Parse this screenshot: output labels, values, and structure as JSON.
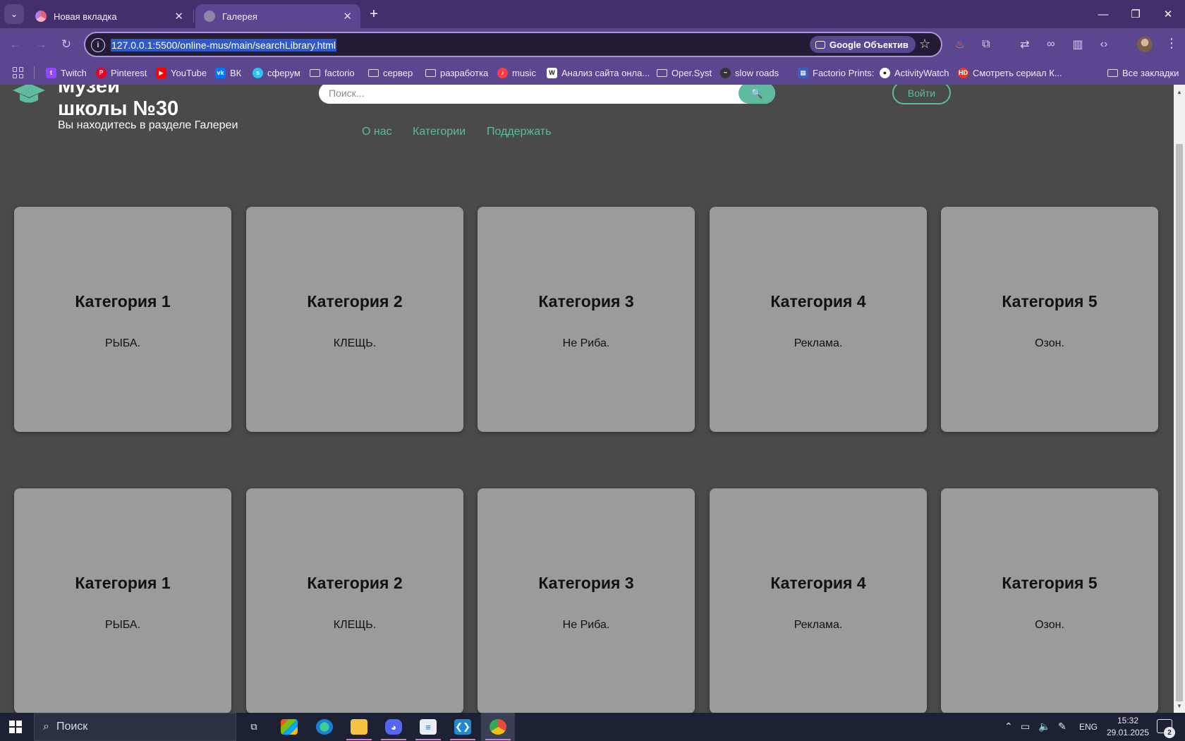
{
  "browser": {
    "tabs": [
      {
        "title": "Новая вкладка",
        "active": false
      },
      {
        "title": "Галерея",
        "active": true
      }
    ],
    "url": "127.0.0.1:5500/online-mus/main/searchLibrary.html",
    "lens_label": "Google Объектив",
    "bookmarks": [
      {
        "label": "Twitch",
        "icon": "twitch-icon",
        "color": "#9146ff"
      },
      {
        "label": "Pinterest",
        "icon": "pinterest-icon",
        "color": "#e60023"
      },
      {
        "label": "YouTube",
        "icon": "youtube-icon",
        "color": "#ff0000"
      },
      {
        "label": "ВК",
        "icon": "vk-icon",
        "color": "#0077ff"
      },
      {
        "label": "сферум",
        "icon": "sferum-icon",
        "color": "#2ec4f0"
      },
      {
        "label": "factorio",
        "icon": "folder-icon"
      },
      {
        "label": "сервер",
        "icon": "folder-icon"
      },
      {
        "label": "разработка",
        "icon": "folder-icon"
      },
      {
        "label": "music",
        "icon": "music-icon",
        "color": "#fc3c44"
      },
      {
        "label": "Анализ сайта онла...",
        "icon": "w-icon",
        "color": "#ffffff"
      },
      {
        "label": "Oper.Syst",
        "icon": "folder-icon"
      },
      {
        "label": "slow roads",
        "icon": "slowroads-icon",
        "color": "#333333"
      },
      {
        "label": "Factorio Prints:",
        "icon": "factorio-prints-icon",
        "color": "#3b5fc0"
      },
      {
        "label": "ActivityWatch",
        "icon": "github-icon",
        "color": "#ffffff"
      },
      {
        "label": "Смотреть сериал К...",
        "icon": "hd-icon",
        "color": "#e8392c"
      }
    ],
    "all_bookmarks_label": "Все закладки"
  },
  "site": {
    "title_line1": "Музей",
    "title_line2": "школы №30",
    "subtitle": "Вы находитесь в разделе Галереи",
    "search_placeholder": "Поиск...",
    "login_label": "Войти",
    "nav": [
      "О нас",
      "Категории",
      "Поддержать"
    ],
    "accent_color": "#5fbaa0",
    "card_rows": [
      [
        {
          "title": "Категория 1",
          "desc": "РЫБА."
        },
        {
          "title": "Категория 2",
          "desc": "КЛЕЩЬ."
        },
        {
          "title": "Категория 3",
          "desc": "Не Риба."
        },
        {
          "title": "Категория 4",
          "desc": "Реклама."
        },
        {
          "title": "Категория 5",
          "desc": "Озон."
        }
      ],
      [
        {
          "title": "Категория 1",
          "desc": "РЫБА."
        },
        {
          "title": "Категория 2",
          "desc": "КЛЕЩЬ."
        },
        {
          "title": "Категория 3",
          "desc": "Не Риба."
        },
        {
          "title": "Категория 4",
          "desc": "Реклама."
        },
        {
          "title": "Категория 5",
          "desc": "Озон."
        }
      ]
    ]
  },
  "taskbar": {
    "search_label": "Поиск",
    "language": "ENG",
    "time": "15:32",
    "date": "29.01.2025",
    "notification_count": "2",
    "apps": [
      "task-view-icon",
      "store-icon",
      "edge-icon",
      "file-explorer-icon",
      "discord-icon",
      "notepad-icon",
      "vscode-icon",
      "chrome-icon"
    ]
  }
}
